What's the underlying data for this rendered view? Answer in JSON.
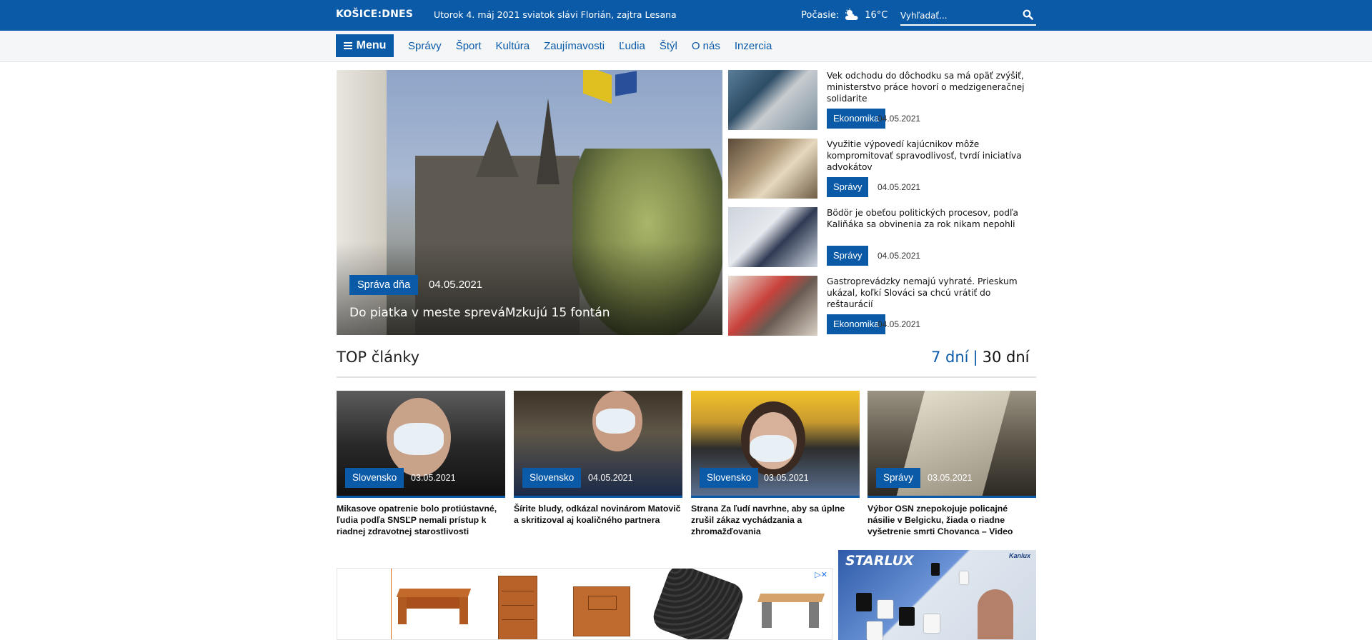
{
  "header": {
    "logo": "KOŠICE:DNES",
    "dateline": "Utorok 4. máj 2021 sviatok slávi Florián, zajtra Lesana",
    "weather_label": "Počasie:",
    "weather_icon": "partly-cloudy-icon",
    "temperature": "16°C",
    "search_placeholder": "Vyhľadať..."
  },
  "nav": {
    "menu_label": "Menu",
    "links": [
      "Správy",
      "Šport",
      "Kultúra",
      "Zaujímavosti",
      "Ľudia",
      "Štýl",
      "O nás",
      "Inzercia"
    ]
  },
  "hero": {
    "category": "Správa dňa",
    "date": "04.05.2021",
    "title": "Do piatka v meste spreváMzkujú 15 fontán"
  },
  "side_articles": [
    {
      "title": "Vek odchodu do dôchodku sa má opäť zvýšiť, ministerstvo práce hovorí o medzigeneračnej solidarite",
      "category": "Ekonomika",
      "date": "04.05.2021"
    },
    {
      "title": "Využitie výpovedí kajúcnikov môže kompromitovať spravodlivosť, tvrdí iniciatíva advokátov",
      "category": "Správy",
      "date": "04.05.2021"
    },
    {
      "title": "Bödör je obeťou politických procesov, podľa Kaliňáka sa obvinenia za rok nikam nepohli",
      "category": "Správy",
      "date": "04.05.2021"
    },
    {
      "title": "Gastroprevádzky nemajú vyhraté. Prieskum ukázal, koľkí Slováci sa chcú vrátiť do reštaurácií",
      "category": "Ekonomika",
      "date": "04.05.2021"
    }
  ],
  "top": {
    "heading": "TOP články",
    "tab_7": "7 dní",
    "separator": "|",
    "tab_30": "30 dní",
    "cards": [
      {
        "category": "Slovensko",
        "date": "03.05.2021",
        "title": "Mikasove opatrenie bolo protiústavné, ľudia podľa SNSĽP nemali prístup k riadnej zdravotnej starostlivosti"
      },
      {
        "category": "Slovensko",
        "date": "04.05.2021",
        "title": "Šírite bludy, odkázal novinárom Matovič a skritizoval aj koaličného partnera"
      },
      {
        "category": "Slovensko",
        "date": "03.05.2021",
        "title": "Strana Za ľudí navrhne, aby sa úplne zrušil zákaz vychádzania a zhromažďovania"
      },
      {
        "category": "Správy",
        "date": "03.05.2021",
        "title": "Výbor OSN znepokojuje policajné násilie v Belgicku, žiada o riadne vyšetrenie smrti Chovanca – Video"
      }
    ]
  },
  "ads": {
    "adchoices": "▷✕",
    "banner_brand": "STARLUX",
    "banner_brand2": "Kanlux"
  },
  "colors": {
    "brand_blue": "#0a5aa8",
    "nav_bg": "#f4f6f8"
  }
}
